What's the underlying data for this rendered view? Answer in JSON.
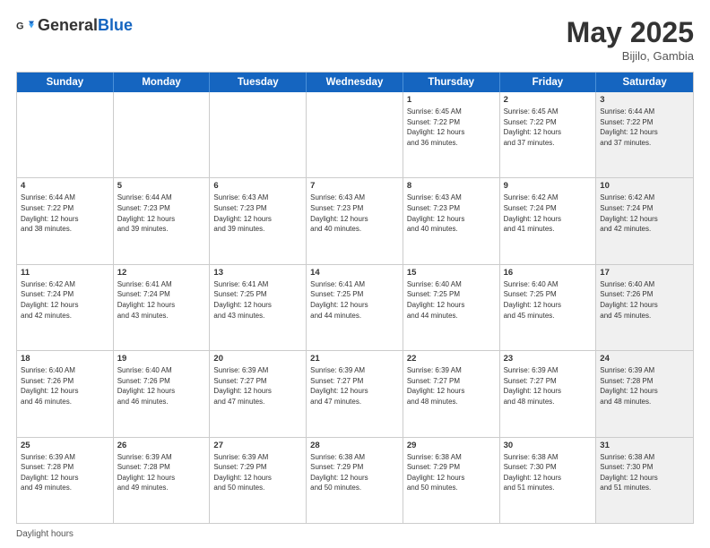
{
  "header": {
    "logo": {
      "general": "General",
      "blue": "Blue"
    },
    "title": "May 2025",
    "location": "Bijilo, Gambia"
  },
  "dayHeaders": [
    "Sunday",
    "Monday",
    "Tuesday",
    "Wednesday",
    "Thursday",
    "Friday",
    "Saturday"
  ],
  "footer": {
    "daylight_label": "Daylight hours"
  },
  "weeks": [
    [
      {
        "day": "",
        "info": "",
        "empty": true
      },
      {
        "day": "",
        "info": "",
        "empty": true
      },
      {
        "day": "",
        "info": "",
        "empty": true
      },
      {
        "day": "",
        "info": "",
        "empty": true
      },
      {
        "day": "1",
        "info": "Sunrise: 6:45 AM\nSunset: 7:22 PM\nDaylight: 12 hours\nand 36 minutes.",
        "empty": false
      },
      {
        "day": "2",
        "info": "Sunrise: 6:45 AM\nSunset: 7:22 PM\nDaylight: 12 hours\nand 37 minutes.",
        "empty": false
      },
      {
        "day": "3",
        "info": "Sunrise: 6:44 AM\nSunset: 7:22 PM\nDaylight: 12 hours\nand 37 minutes.",
        "empty": false,
        "shaded": true
      }
    ],
    [
      {
        "day": "4",
        "info": "Sunrise: 6:44 AM\nSunset: 7:22 PM\nDaylight: 12 hours\nand 38 minutes.",
        "empty": false
      },
      {
        "day": "5",
        "info": "Sunrise: 6:44 AM\nSunset: 7:23 PM\nDaylight: 12 hours\nand 39 minutes.",
        "empty": false
      },
      {
        "day": "6",
        "info": "Sunrise: 6:43 AM\nSunset: 7:23 PM\nDaylight: 12 hours\nand 39 minutes.",
        "empty": false
      },
      {
        "day": "7",
        "info": "Sunrise: 6:43 AM\nSunset: 7:23 PM\nDaylight: 12 hours\nand 40 minutes.",
        "empty": false
      },
      {
        "day": "8",
        "info": "Sunrise: 6:43 AM\nSunset: 7:23 PM\nDaylight: 12 hours\nand 40 minutes.",
        "empty": false
      },
      {
        "day": "9",
        "info": "Sunrise: 6:42 AM\nSunset: 7:24 PM\nDaylight: 12 hours\nand 41 minutes.",
        "empty": false
      },
      {
        "day": "10",
        "info": "Sunrise: 6:42 AM\nSunset: 7:24 PM\nDaylight: 12 hours\nand 42 minutes.",
        "empty": false,
        "shaded": true
      }
    ],
    [
      {
        "day": "11",
        "info": "Sunrise: 6:42 AM\nSunset: 7:24 PM\nDaylight: 12 hours\nand 42 minutes.",
        "empty": false
      },
      {
        "day": "12",
        "info": "Sunrise: 6:41 AM\nSunset: 7:24 PM\nDaylight: 12 hours\nand 43 minutes.",
        "empty": false
      },
      {
        "day": "13",
        "info": "Sunrise: 6:41 AM\nSunset: 7:25 PM\nDaylight: 12 hours\nand 43 minutes.",
        "empty": false
      },
      {
        "day": "14",
        "info": "Sunrise: 6:41 AM\nSunset: 7:25 PM\nDaylight: 12 hours\nand 44 minutes.",
        "empty": false
      },
      {
        "day": "15",
        "info": "Sunrise: 6:40 AM\nSunset: 7:25 PM\nDaylight: 12 hours\nand 44 minutes.",
        "empty": false
      },
      {
        "day": "16",
        "info": "Sunrise: 6:40 AM\nSunset: 7:25 PM\nDaylight: 12 hours\nand 45 minutes.",
        "empty": false
      },
      {
        "day": "17",
        "info": "Sunrise: 6:40 AM\nSunset: 7:26 PM\nDaylight: 12 hours\nand 45 minutes.",
        "empty": false,
        "shaded": true
      }
    ],
    [
      {
        "day": "18",
        "info": "Sunrise: 6:40 AM\nSunset: 7:26 PM\nDaylight: 12 hours\nand 46 minutes.",
        "empty": false
      },
      {
        "day": "19",
        "info": "Sunrise: 6:40 AM\nSunset: 7:26 PM\nDaylight: 12 hours\nand 46 minutes.",
        "empty": false
      },
      {
        "day": "20",
        "info": "Sunrise: 6:39 AM\nSunset: 7:27 PM\nDaylight: 12 hours\nand 47 minutes.",
        "empty": false
      },
      {
        "day": "21",
        "info": "Sunrise: 6:39 AM\nSunset: 7:27 PM\nDaylight: 12 hours\nand 47 minutes.",
        "empty": false
      },
      {
        "day": "22",
        "info": "Sunrise: 6:39 AM\nSunset: 7:27 PM\nDaylight: 12 hours\nand 48 minutes.",
        "empty": false
      },
      {
        "day": "23",
        "info": "Sunrise: 6:39 AM\nSunset: 7:27 PM\nDaylight: 12 hours\nand 48 minutes.",
        "empty": false
      },
      {
        "day": "24",
        "info": "Sunrise: 6:39 AM\nSunset: 7:28 PM\nDaylight: 12 hours\nand 48 minutes.",
        "empty": false,
        "shaded": true
      }
    ],
    [
      {
        "day": "25",
        "info": "Sunrise: 6:39 AM\nSunset: 7:28 PM\nDaylight: 12 hours\nand 49 minutes.",
        "empty": false
      },
      {
        "day": "26",
        "info": "Sunrise: 6:39 AM\nSunset: 7:28 PM\nDaylight: 12 hours\nand 49 minutes.",
        "empty": false
      },
      {
        "day": "27",
        "info": "Sunrise: 6:39 AM\nSunset: 7:29 PM\nDaylight: 12 hours\nand 50 minutes.",
        "empty": false
      },
      {
        "day": "28",
        "info": "Sunrise: 6:38 AM\nSunset: 7:29 PM\nDaylight: 12 hours\nand 50 minutes.",
        "empty": false
      },
      {
        "day": "29",
        "info": "Sunrise: 6:38 AM\nSunset: 7:29 PM\nDaylight: 12 hours\nand 50 minutes.",
        "empty": false
      },
      {
        "day": "30",
        "info": "Sunrise: 6:38 AM\nSunset: 7:30 PM\nDaylight: 12 hours\nand 51 minutes.",
        "empty": false
      },
      {
        "day": "31",
        "info": "Sunrise: 6:38 AM\nSunset: 7:30 PM\nDaylight: 12 hours\nand 51 minutes.",
        "empty": false,
        "shaded": true
      }
    ]
  ]
}
